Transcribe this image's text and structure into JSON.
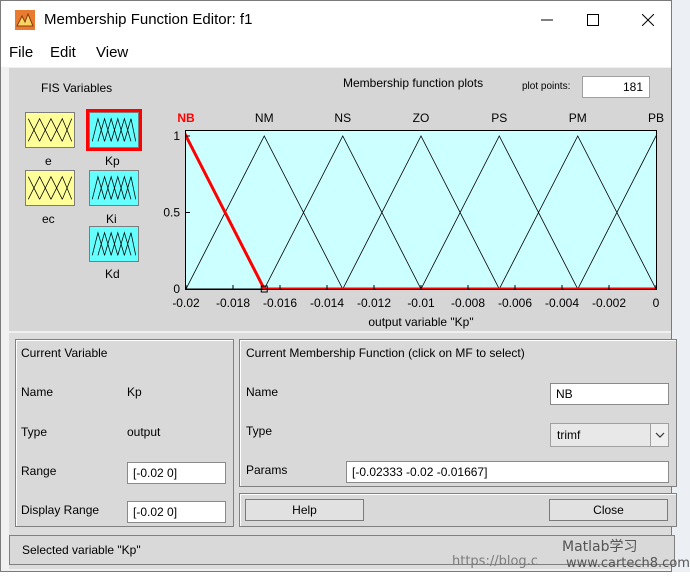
{
  "window": {
    "title": "Membership Function Editor: f1"
  },
  "menu": [
    "File",
    "Edit",
    "View"
  ],
  "fis_vars": {
    "heading": "FIS Variables",
    "inputs": [
      {
        "name": "e"
      },
      {
        "name": "ec"
      }
    ],
    "outputs": [
      {
        "name": "Kp",
        "selected": true
      },
      {
        "name": "Ki"
      },
      {
        "name": "Kd"
      }
    ]
  },
  "plot": {
    "title": "Membership function plots",
    "points_label": "plot points:",
    "points_value": "181",
    "xlabel": "output variable \"Kp\""
  },
  "chart_data": {
    "type": "line",
    "title": "Membership function plots",
    "xlabel": "output variable \"Kp\"",
    "ylabel": "",
    "xlim": [
      -0.02,
      0
    ],
    "ylim": [
      0,
      1
    ],
    "xticks": [
      -0.02,
      -0.018,
      -0.016,
      -0.014,
      -0.012,
      -0.01,
      -0.008,
      -0.006,
      -0.004,
      -0.002,
      0
    ],
    "xtick_labels": [
      "-0.02",
      "-0.018",
      "-0.016",
      "-0.014",
      "-0.012",
      "-0.01",
      "-0.008",
      "-0.006",
      "-0.004",
      "-0.002",
      "0"
    ],
    "yticks": [
      0,
      0.5,
      1
    ],
    "ytick_labels": [
      "0",
      "0.5",
      "1"
    ],
    "grid": false,
    "series": [
      {
        "name": "NB",
        "params": [
          -0.02333,
          -0.02,
          -0.01667
        ],
        "selected": true
      },
      {
        "name": "NM",
        "params": [
          -0.02,
          -0.01667,
          -0.01333
        ]
      },
      {
        "name": "NS",
        "params": [
          -0.01667,
          -0.01333,
          -0.01
        ]
      },
      {
        "name": "ZO",
        "params": [
          -0.01333,
          -0.01,
          -0.00667
        ]
      },
      {
        "name": "PS",
        "params": [
          -0.01,
          -0.00667,
          -0.00333
        ]
      },
      {
        "name": "PM",
        "params": [
          -0.00667,
          -0.00333,
          0
        ]
      },
      {
        "name": "PB",
        "params": [
          -0.00333,
          0,
          0.00333
        ]
      }
    ]
  },
  "current_variable": {
    "heading": "Current Variable",
    "name_label": "Name",
    "name_value": "Kp",
    "type_label": "Type",
    "type_value": "output",
    "range_label": "Range",
    "range_value": "[-0.02 0]",
    "display_range_label": "Display Range",
    "display_range_value": "[-0.02 0]"
  },
  "current_mf": {
    "heading": "Current Membership Function (click on MF to select)",
    "name_label": "Name",
    "name_value": "NB",
    "type_label": "Type",
    "type_value": "trimf",
    "params_label": "Params",
    "params_value": "[-0.02333 -0.02 -0.01667]"
  },
  "buttons": {
    "help": "Help",
    "close": "Close"
  },
  "status": "Selected variable \"Kp\"",
  "watermark": {
    "url": "https://blog.c",
    "brand": "Matlab学习",
    "site": "www.cartech8.com"
  },
  "colors": {
    "plot_bg": "#ccffff",
    "selected_mf": "#ff0000",
    "input_box": "#ffff99",
    "output_box": "#66ffff"
  }
}
